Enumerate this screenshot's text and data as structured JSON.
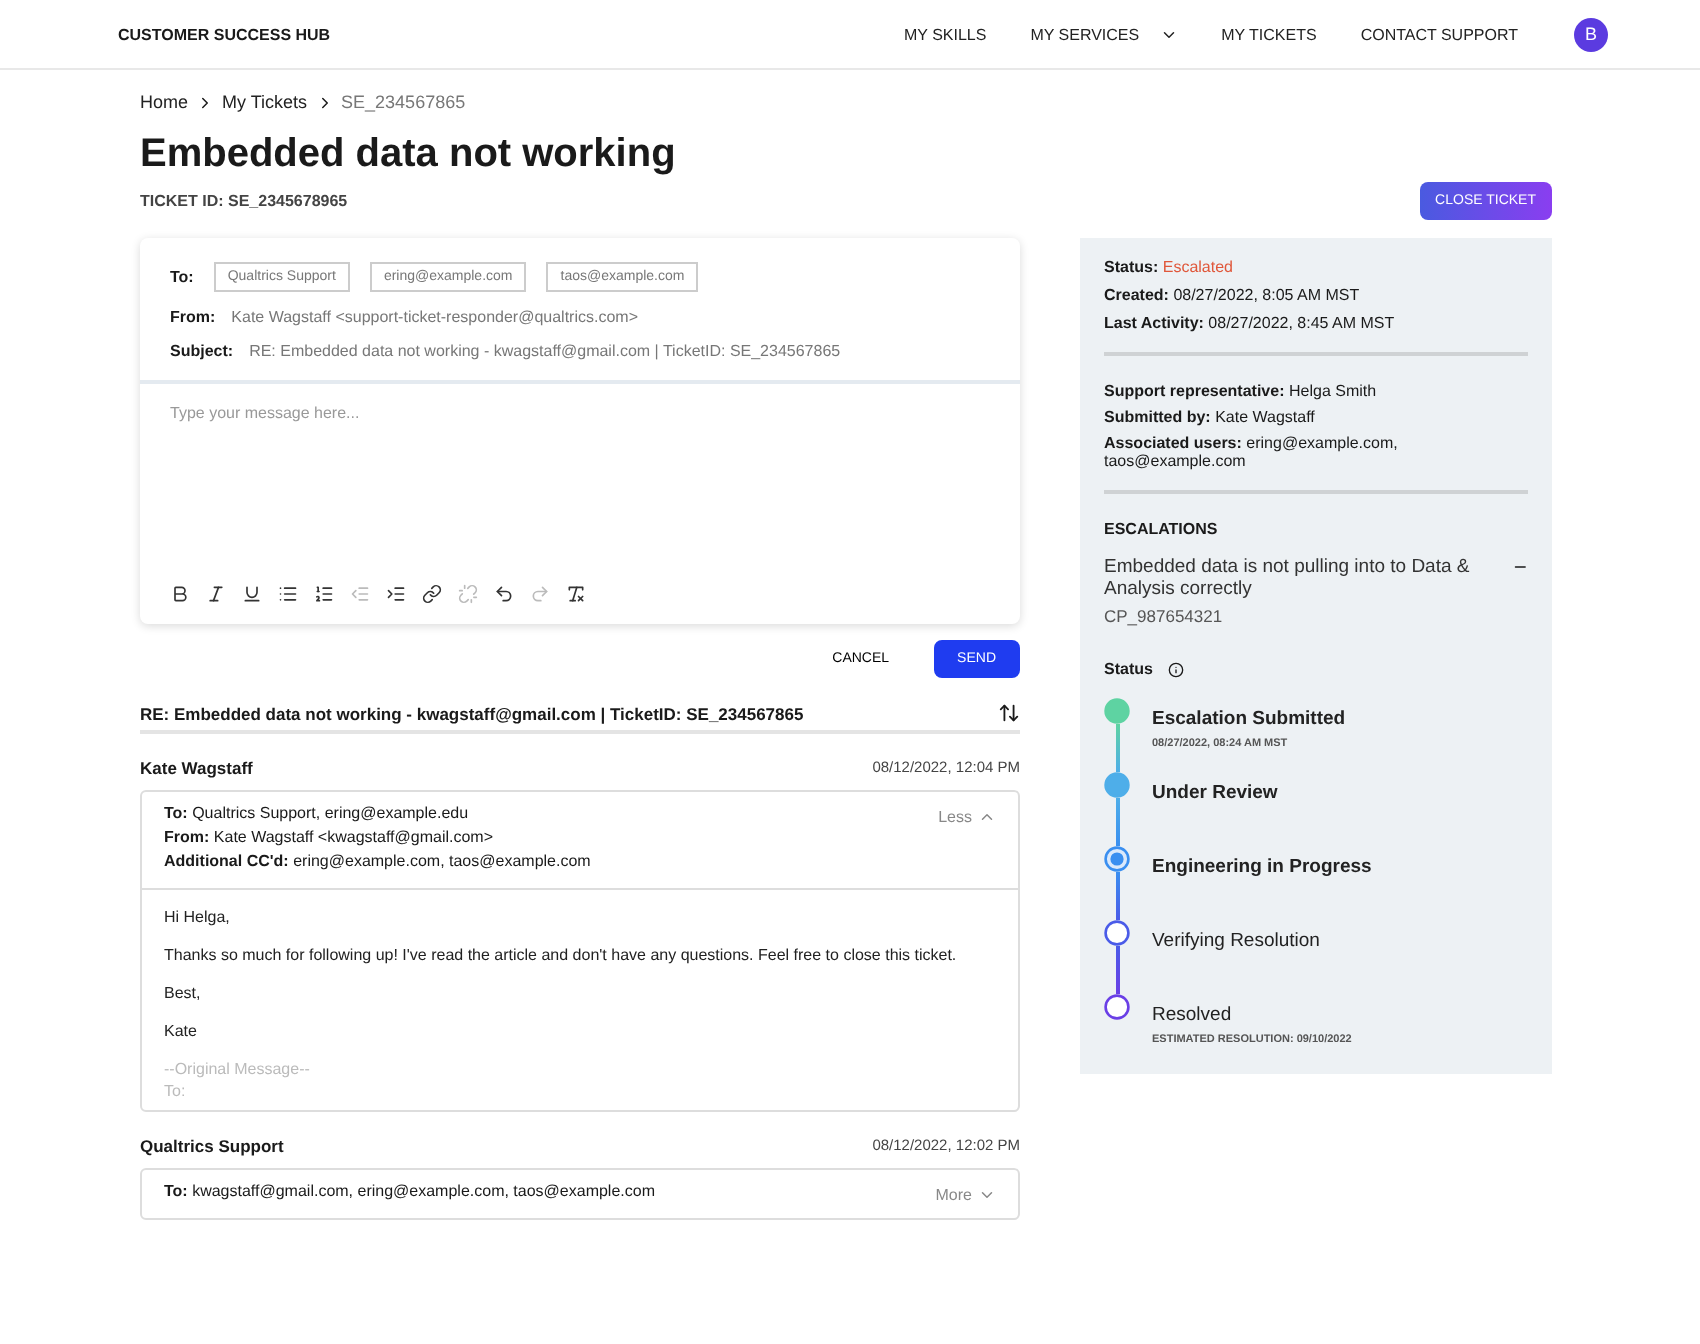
{
  "header": {
    "brand": "CUSTOMER SUCCESS HUB",
    "nav": [
      {
        "label": "MY SKILLS",
        "dropdown": false
      },
      {
        "label": "MY SERVICES",
        "dropdown": true
      },
      {
        "label": "MY TICKETS",
        "dropdown": false
      },
      {
        "label": "CONTACT SUPPORT",
        "dropdown": false
      }
    ],
    "avatar": "B"
  },
  "breadcrumb": [
    {
      "label": "Home",
      "current": false
    },
    {
      "label": "My Tickets",
      "current": false
    },
    {
      "label": "SE_234567865",
      "current": true
    }
  ],
  "title": "Embedded data not working",
  "ticket_id": "TICKET ID: SE_2345678965",
  "close_button": "CLOSE TICKET",
  "compose": {
    "to_label": "To:",
    "recipients": [
      "Qualtrics Support",
      "ering@example.com",
      "taos@example.com"
    ],
    "from_label": "From:",
    "from": "Kate Wagstaff <support-ticket-responder@qualtrics.com>",
    "subject_label": "Subject:",
    "subject": "RE: Embedded data not working - kwagstaff@gmail.com | TicketID: SE_234567865",
    "placeholder": "Type your message here...",
    "tools": [
      {
        "kind": "bold",
        "disabled": false
      },
      {
        "kind": "italic",
        "disabled": false
      },
      {
        "kind": "underline",
        "disabled": false
      },
      {
        "kind": "bullets",
        "disabled": false
      },
      {
        "kind": "numbers",
        "disabled": false
      },
      {
        "kind": "outdent",
        "disabled": true
      },
      {
        "kind": "indent",
        "disabled": false
      },
      {
        "kind": "link",
        "disabled": false
      },
      {
        "kind": "unlink",
        "disabled": true
      },
      {
        "kind": "undo",
        "disabled": false
      },
      {
        "kind": "redo",
        "disabled": true
      },
      {
        "kind": "clear",
        "disabled": false
      }
    ],
    "cancel": "CANCEL",
    "send": "SEND"
  },
  "thread": {
    "subject": "RE: Embedded data not working - kwagstaff@gmail.com | TicketID: SE_234567865",
    "messages": [
      {
        "sender": "Kate Wagstaff",
        "time": "08/12/2022, 12:04 PM",
        "expanded": true,
        "toggle": "Less",
        "meta": [
          {
            "label": "To:",
            "value": "Qualtrics Support, ering@example.edu"
          },
          {
            "label": "From:",
            "value": "Kate Wagstaff <kwagstaff@gmail.com>"
          },
          {
            "label": "Additional CC'd:",
            "value": "ering@example.com, taos@example.com"
          }
        ],
        "body": [
          {
            "kind": "text",
            "text": "Hi Helga,"
          },
          {
            "kind": "text",
            "text": "Thanks so much for following up! I've read the article and don't have any questions. Feel free to close this ticket."
          },
          {
            "kind": "text",
            "text": "Best,"
          },
          {
            "kind": "text",
            "text": "Kate"
          },
          {
            "kind": "quote",
            "text": "--Original Message--"
          },
          {
            "kind": "quote",
            "text": "To:"
          }
        ]
      },
      {
        "sender": "Qualtrics Support",
        "time": "08/12/2022, 12:02 PM",
        "expanded": false,
        "toggle": "More",
        "meta": [
          {
            "label": "To:",
            "value": "kwagstaff@gmail.com, ering@example.com, taos@example.com"
          }
        ]
      }
    ]
  },
  "sidebar": {
    "status_label": "Status:",
    "status": "Escalated",
    "info": [
      {
        "label": "Created:",
        "value": "08/27/2022, 8:05 AM MST"
      },
      {
        "label": "Last Activity:",
        "value": "08/27/2022, 8:45 AM MST"
      }
    ],
    "people": [
      {
        "label": "Support representative:",
        "value": "Helga Smith"
      },
      {
        "label": "Submitted by:",
        "value": "Kate Wagstaff"
      },
      {
        "label": "Associated users:",
        "value": "ering@example.com, taos@example.com"
      }
    ],
    "escalations_title": "ESCALATIONS",
    "escalation": {
      "title": "Embedded data is not pulling into to Data & Analysis correctly",
      "id": "CP_987654321",
      "expanded": true
    },
    "status_heading": "Status",
    "steps": [
      {
        "label": "Escalation Submitted",
        "note": "08/27/2022, 08:24 AM MST",
        "kind": "complete",
        "color": "#5ed3a2"
      },
      {
        "label": "Under Review",
        "kind": "complete",
        "color": "#4eaee9"
      },
      {
        "label": "Engineering in Progress",
        "kind": "current",
        "color": "#3a8ff0"
      },
      {
        "label": "Verifying Resolution",
        "kind": "pending",
        "color": "#4a5be8"
      },
      {
        "label": "Resolved",
        "note": "ESTIMATED RESOLUTION: 09/10/2022",
        "kind": "pending",
        "color": "#6a3fe6"
      }
    ]
  }
}
